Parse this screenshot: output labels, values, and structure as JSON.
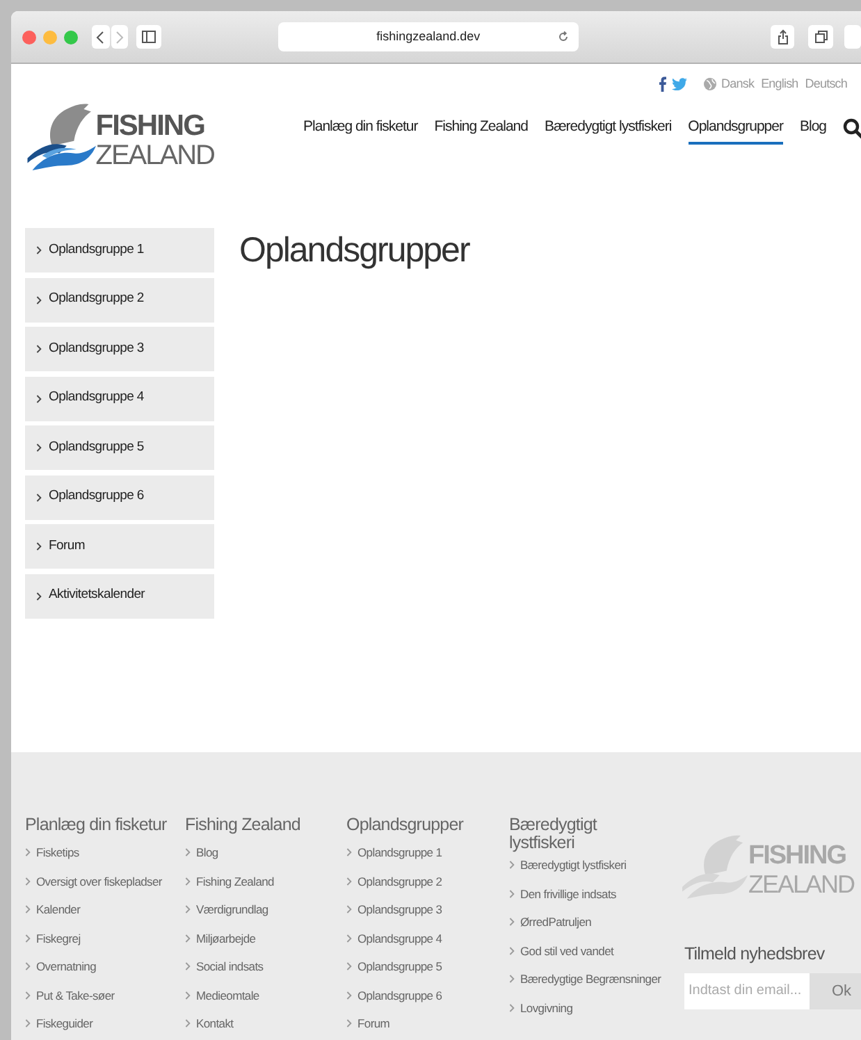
{
  "browser": {
    "url": "fishingzealand.dev"
  },
  "logo": {
    "line_1": "FISHING",
    "line_2": "ZEALAND"
  },
  "languages": [
    "Dansk",
    "English",
    "Deutsch"
  ],
  "nav": [
    {
      "label": "Planlæg din fisketur",
      "selected": false
    },
    {
      "label": "Fishing Zealand",
      "selected": false
    },
    {
      "label": "Bæredygtigt lystfiskeri",
      "selected": false
    },
    {
      "label": "Oplandsgrupper",
      "selected": true
    },
    {
      "label": "Blog",
      "selected": false
    }
  ],
  "sidebar": [
    "Oplandsgruppe 1",
    "Oplandsgruppe 2",
    "Oplandsgruppe 3",
    "Oplandsgruppe 4",
    "Oplandsgruppe 5",
    "Oplandsgruppe 6",
    "Forum",
    "Aktivitetskalender"
  ],
  "page_title": "Oplandsgrupper",
  "footer": {
    "columns": [
      {
        "heading": "Planlæg din fisketur",
        "links": [
          "Fisketips",
          "Oversigt over fiskepladser",
          "Kalender",
          "Fiskegrej",
          "Overnatning",
          "Put & Take-søer",
          "Fiskeguider"
        ]
      },
      {
        "heading": "Fishing Zealand",
        "links": [
          "Blog",
          "Fishing Zealand",
          "Værdigrundlag",
          "Miljøarbejde",
          "Social indsats",
          "Medieomtale",
          "Kontakt"
        ]
      },
      {
        "heading": "Oplandsgrupper",
        "links": [
          "Oplandsgruppe 1",
          "Oplandsgruppe 2",
          "Oplandsgruppe 3",
          "Oplandsgruppe 4",
          "Oplandsgruppe 5",
          "Oplandsgruppe 6",
          "Forum"
        ]
      },
      {
        "heading": "Bæredygtigt lystfiskeri",
        "links": [
          "Bæredygtigt lystfiskeri",
          "Den frivillige indsats",
          "ØrredPatruljen",
          "God stil ved vandet",
          "Bæredygtige Begrænsninger",
          "Lovgivning"
        ]
      }
    ],
    "logo": {
      "line_1": "FISHING",
      "line_2": "ZEALAND"
    },
    "newsletter": {
      "heading": "Tilmeld nyhedsbrev",
      "placeholder": "Indtast din email...",
      "button": "Ok"
    }
  }
}
